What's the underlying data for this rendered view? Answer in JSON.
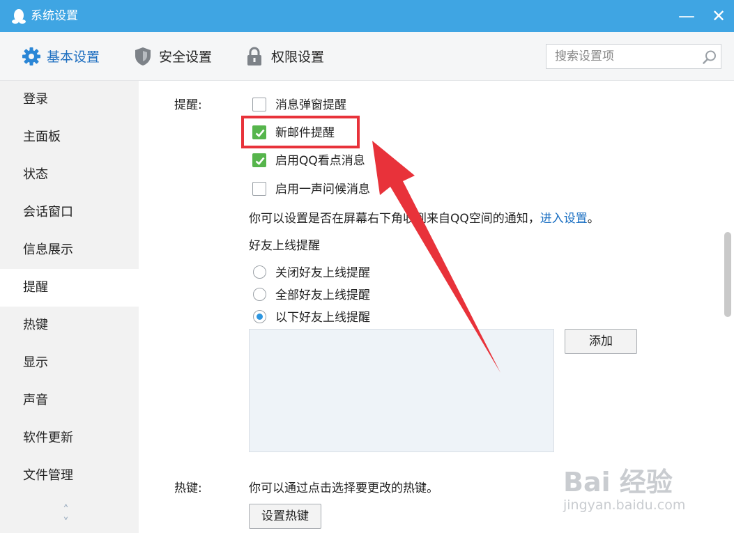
{
  "window": {
    "title": "系统设置",
    "minimize_label": "—",
    "close_label": "✕"
  },
  "tabs": [
    {
      "label": "基本设置",
      "icon": "gear-icon",
      "active": true
    },
    {
      "label": "安全设置",
      "icon": "shield-icon",
      "active": false
    },
    {
      "label": "权限设置",
      "icon": "lock-icon",
      "active": false
    }
  ],
  "search": {
    "placeholder": "搜索设置项",
    "icon": "search-icon"
  },
  "sidebar": {
    "items": [
      {
        "label": "登录"
      },
      {
        "label": "主面板"
      },
      {
        "label": "状态"
      },
      {
        "label": "会话窗口"
      },
      {
        "label": "信息展示"
      },
      {
        "label": "提醒",
        "active": true
      },
      {
        "label": "热键"
      },
      {
        "label": "显示"
      },
      {
        "label": "声音"
      },
      {
        "label": "软件更新"
      },
      {
        "label": "文件管理"
      }
    ],
    "scroll_icons": {
      "up": "˄",
      "down": "˅"
    }
  },
  "reminder": {
    "section_label": "提醒:",
    "options": [
      {
        "label": "消息弹窗提醒",
        "checked": false
      },
      {
        "label": "新邮件提醒",
        "checked": true
      },
      {
        "label": "启用QQ看点消息",
        "checked": true
      },
      {
        "label": "启用一声问候消息",
        "checked": false
      }
    ],
    "qzone_text": "你可以设置是否在屏幕右下角收到来自QQ空间的通知，",
    "qzone_link": "进入设置",
    "qzone_end": "。",
    "friend_online_title": "好友上线提醒",
    "friend_options": [
      {
        "label": "关闭好友上线提醒",
        "selected": false
      },
      {
        "label": "全部好友上线提醒",
        "selected": false
      },
      {
        "label": "以下好友上线提醒",
        "selected": true
      }
    ],
    "add_button": "添加"
  },
  "hotkey": {
    "section_label": "热键:",
    "description": "你可以通过点击选择要更改的热键。",
    "button": "设置热键"
  },
  "watermark": {
    "text": "Bai 经验",
    "url_text": "jingyan.baidu.com"
  },
  "colors": {
    "titlebar": "#3fa5e3",
    "active_tab": "#1e6fc0",
    "checkbox_on": "#56b54c",
    "annotation": "#e8323a"
  }
}
